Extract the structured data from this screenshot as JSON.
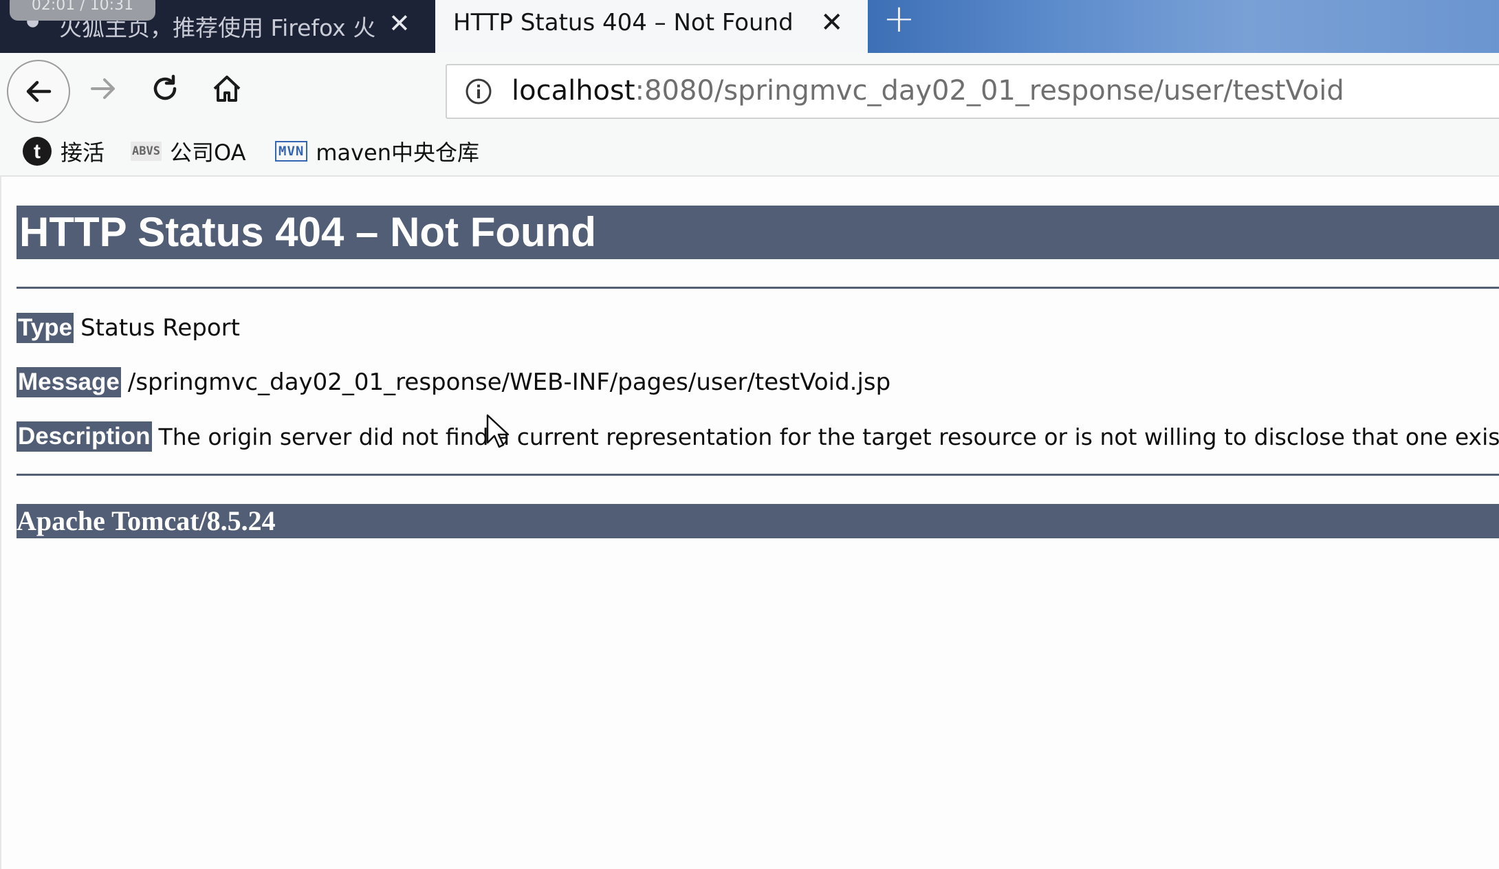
{
  "browser": {
    "tabs": [
      {
        "title": "火狐主页，推荐使用 Firefox 火狐",
        "active": false
      },
      {
        "title": "HTTP Status 404 – Not Found",
        "active": true
      }
    ],
    "close_glyph": "✕",
    "newtab_glyph": "+",
    "video_time": "02:01 / 10:31",
    "url": {
      "host": "localhost",
      "rest": ":8080/springmvc_day02_01_response/user/testVoid"
    },
    "bookmarks": [
      {
        "icon": "t-icon",
        "label": "接活"
      },
      {
        "icon": "abvs-icon",
        "icon_text": "ABVS",
        "label": "公司OA"
      },
      {
        "icon": "mvn-icon",
        "icon_text": "MVN",
        "label": "maven中央仓库"
      }
    ]
  },
  "page": {
    "heading": "HTTP Status 404 – Not Found",
    "type_label": "Type",
    "type_value": "Status Report",
    "message_label": "Message",
    "message_value": "/springmvc_day02_01_response/WEB-INF/pages/user/testVoid.jsp",
    "description_label": "Description",
    "description_value": "The origin server did not find a current representation for the target resource or is not willing to disclose that one exists.",
    "footer": "Apache Tomcat/8.5.24"
  },
  "colors": {
    "tomcat_bar": "#525d76",
    "tabbar": "#1d2336"
  }
}
